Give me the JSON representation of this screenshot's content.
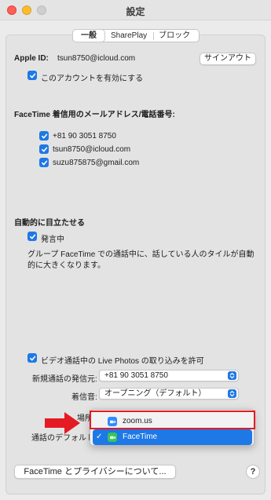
{
  "window": {
    "title": "設定"
  },
  "tabs": [
    {
      "label": "一般"
    },
    {
      "label": "SharePlay"
    },
    {
      "label": "ブロック"
    }
  ],
  "account": {
    "apple_id_label": "Apple ID:",
    "apple_id": "tsun8750@icloud.com",
    "sign_out_label": "サインアウト",
    "enable_label": "このアカウントを有効にする"
  },
  "reachable": {
    "heading": "FaceTime 着信用のメールアドレス/電話番号:",
    "items": [
      {
        "label": "+81 90 3051 8750"
      },
      {
        "label": "tsun8750@icloud.com"
      },
      {
        "label": "suzu875875@gmail.com"
      }
    ]
  },
  "prominence": {
    "heading": "自動的に目立たせる",
    "speaking_label": "発言中",
    "description_line1": "グループ FaceTime での通話中に、話している人のタイルが自動",
    "description_line2": "的に大きくなります。"
  },
  "live_photos_label": "ビデオ通話中の Live Photos の取り込みを許可",
  "caller_id": {
    "label": "新規通話の発信元:",
    "value": "+81 90 3051 8750"
  },
  "ringtone": {
    "label": "着信音:",
    "value": "オープニング（デフォルト）"
  },
  "location": {
    "label": "場所"
  },
  "default_app": {
    "label": "通話のデフォルト"
  },
  "app_menu": {
    "items": [
      {
        "label": "zoom.us",
        "selected": false,
        "checked": false
      },
      {
        "label": "FaceTime",
        "selected": true,
        "checked": true
      }
    ]
  },
  "privacy_button_label": "FaceTime とプライバシーについて...",
  "help_label": "?",
  "colors": {
    "accent": "#1e78e6",
    "highlight_box": "#e41b23",
    "arrow": "#e41b23",
    "zoom_icon": "#2d8cff",
    "facetime_icon": "#34c759"
  }
}
